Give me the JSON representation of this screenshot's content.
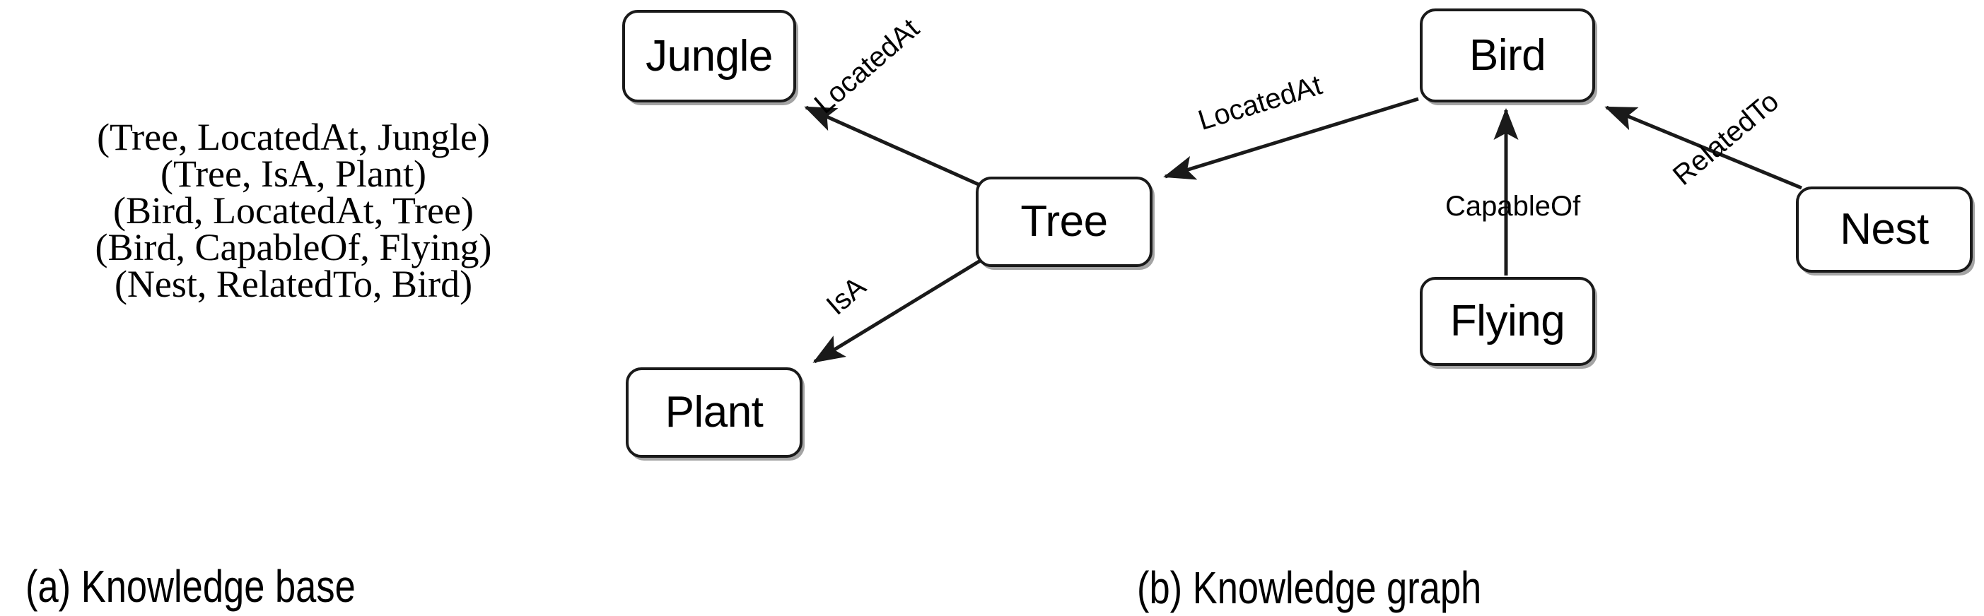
{
  "figure": {
    "panels": [
      {
        "id": "a",
        "caption": "(a) Knowledge base"
      },
      {
        "id": "b",
        "caption": "(b) Knowledge graph"
      }
    ]
  },
  "knowledge_base": {
    "triples": [
      "(Tree, LocatedAt, Jungle)",
      "(Tree, IsA, Plant)",
      "(Bird, LocatedAt, Tree)",
      "(Bird, CapableOf, Flying)",
      "(Nest, RelatedTo, Bird)"
    ]
  },
  "knowledge_graph": {
    "nodes": [
      {
        "id": "jungle",
        "label": "Jungle"
      },
      {
        "id": "tree",
        "label": "Tree"
      },
      {
        "id": "plant",
        "label": "Plant"
      },
      {
        "id": "bird",
        "label": "Bird"
      },
      {
        "id": "flying",
        "label": "Flying"
      },
      {
        "id": "nest",
        "label": "Nest"
      }
    ],
    "edges": [
      {
        "id": "tree-jungle",
        "source": "Tree",
        "target": "Jungle",
        "label": "LocatedAt"
      },
      {
        "id": "tree-plant",
        "source": "Tree",
        "target": "Plant",
        "label": "IsA"
      },
      {
        "id": "bird-tree",
        "source": "Bird",
        "target": "Tree",
        "label": "LocatedAt"
      },
      {
        "id": "flying-bird",
        "source": "Flying",
        "target": "Bird",
        "label": "CapableOf"
      },
      {
        "id": "nest-bird",
        "source": "Nest",
        "target": "Bird",
        "label": "RelatedTo"
      }
    ],
    "colors": {
      "node_border": "#1a1a1a",
      "node_fill": "#ffffff",
      "edge_stroke": "#1a1a1a",
      "text": "#000000"
    }
  }
}
